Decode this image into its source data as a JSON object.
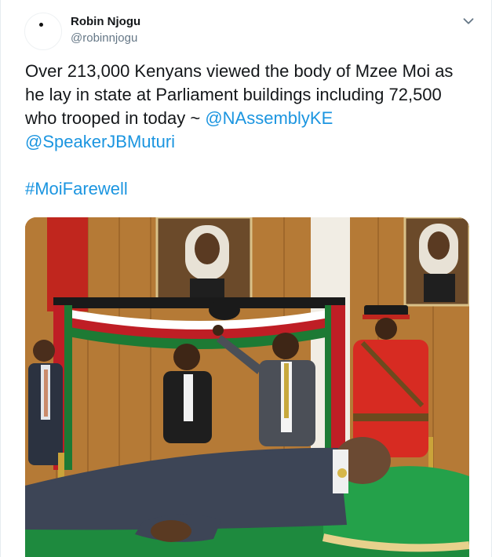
{
  "tweet": {
    "author_name": "Robin Njogu",
    "author_handle": "@robinnjogu",
    "text_main": "Over 213,000 Kenyans viewed the body of Mzee Moi as he lay in state at Parliament buildings including 72,500 who trooped in today ~ ",
    "mention_1": "@NAssemblyKE",
    "mention_2": "@SpeakerJBMuturi",
    "hashtag": "#MoiFarewell",
    "link_color": "#1b95e0"
  },
  "icons": {
    "menu": "chevron-down-icon"
  }
}
